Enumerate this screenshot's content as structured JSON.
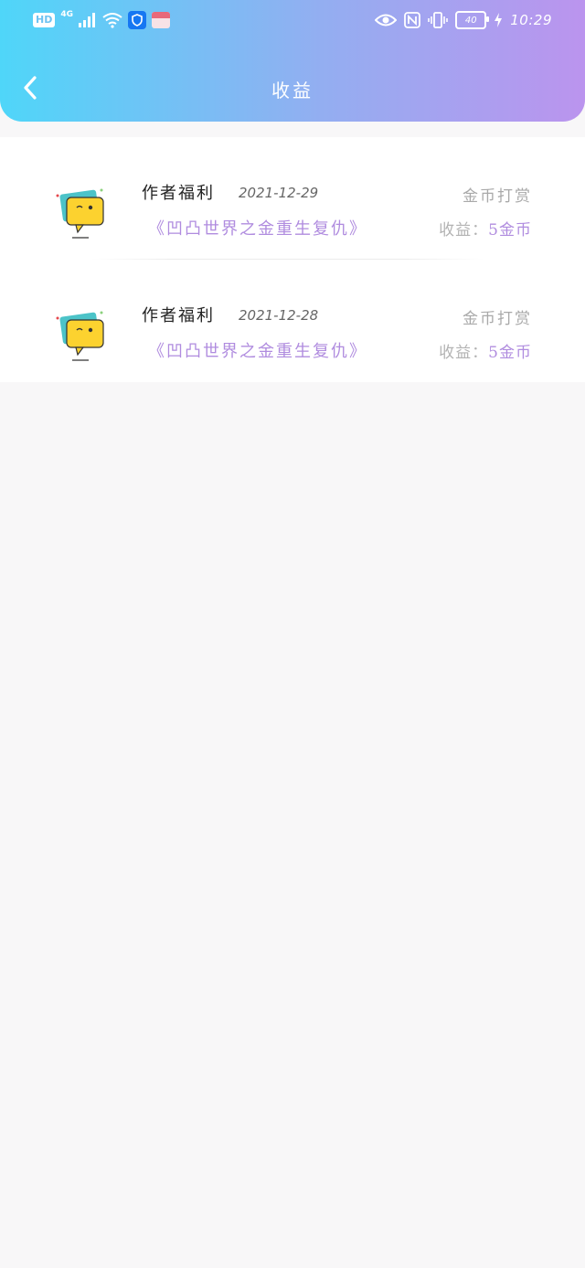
{
  "status_bar": {
    "hd": "HD",
    "network": "4G",
    "battery": "40",
    "time": "10:29"
  },
  "header": {
    "title": "收益",
    "back_icon": "chevron-left-icon"
  },
  "colors": {
    "gradient_start": "#4fd6f9",
    "gradient_end": "#bb94ee",
    "accent_purple": "#b08cdf"
  },
  "records": [
    {
      "author": "作者福利",
      "date": "2021-12-29",
      "type": "金币打赏",
      "book": "《凹凸世界之金重生复仇》",
      "earn_label": "收益：",
      "earn_value": "5金币"
    },
    {
      "author": "作者福利",
      "date": "2021-12-28",
      "type": "金币打赏",
      "book": "《凹凸世界之金重生复仇》",
      "earn_label": "收益：",
      "earn_value": "5金币"
    }
  ]
}
